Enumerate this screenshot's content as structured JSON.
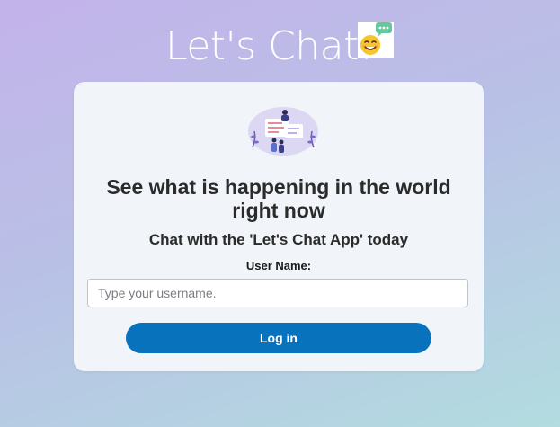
{
  "header": {
    "title": "Let's Chat!",
    "logo_icon": "smiling-emoji-speech-bubble-icon"
  },
  "card": {
    "illustration_icon": "people-chatting-illustration",
    "headline": "See what is happening in the world right now",
    "subheadline": "Chat with the 'Let's Chat App' today",
    "username_label": "User Name:",
    "username_placeholder": "Type your username.",
    "username_value": "",
    "login_label": "Log in"
  },
  "colors": {
    "background_start": "#c3b3ea",
    "background_end": "#b2dcdf",
    "card_background": "#f1f4f9",
    "button": "#0872bd",
    "title_text": "#ffffff"
  }
}
